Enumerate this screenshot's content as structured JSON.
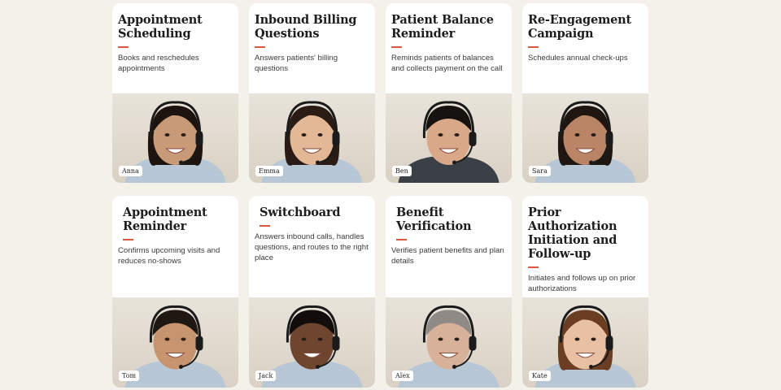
{
  "agents": [
    {
      "title": "Appointment Scheduling",
      "description": "Books and reschedules appointments",
      "name": "Anna",
      "avatar_icon": "female-agent-headset-avatar",
      "skin": "#c99a78",
      "hair": "#1e140f",
      "shirt": "#b7c7d6"
    },
    {
      "title": "Inbound Billing Questions",
      "description": "Answers patients' billing questions",
      "name": "Emma",
      "avatar_icon": "female-agent-headset-avatar",
      "skin": "#e2b897",
      "hair": "#2a1c14",
      "shirt": "#b7c7d6"
    },
    {
      "title": "Patient Balance Reminder",
      "description": "Reminds patients of balances and collects payment on the call",
      "name": "Ben",
      "avatar_icon": "male-agent-headset-avatar",
      "skin": "#d8a888",
      "hair": "#151210",
      "shirt": "#3b3f46"
    },
    {
      "title": "Re-Engagement Campaign",
      "description": "Schedules annual check-ups",
      "name": "Sara",
      "avatar_icon": "female-agent-headset-avatar",
      "skin": "#b98566",
      "hair": "#1f1611",
      "shirt": "#b7c7d6"
    },
    {
      "title": "Appointment Reminder",
      "description": "Confirms upcoming visits and reduces no-shows",
      "name": "Tom",
      "avatar_icon": "male-agent-headset-avatar",
      "skin": "#c79470",
      "hair": "#1e1712",
      "shirt": "#b7c7d6"
    },
    {
      "title": "Switchboard",
      "description": "Answers inbound calls, handles questions, and routes to the right place",
      "name": "Jack",
      "avatar_icon": "male-agent-headset-avatar",
      "skin": "#6e4630",
      "hair": "#120d0a",
      "shirt": "#b7c7d6"
    },
    {
      "title": "Benefit Verification",
      "description": "Verifies patient benefits and plan details",
      "name": "Alex",
      "avatar_icon": "male-agent-headset-avatar",
      "skin": "#d7b19a",
      "hair": "#8f8a86",
      "shirt": "#b7c7d6"
    },
    {
      "title": "Prior Authorization Initiation and Follow-up",
      "description": "Initiates and follows up on prior authorizations",
      "name": "Kate",
      "avatar_icon": "female-agent-headset-avatar",
      "skin": "#e8c0a4",
      "hair": "#6b3e24",
      "shirt": "#b7c7d6"
    }
  ],
  "colors": {
    "background": "#f4f1ea",
    "card": "#ffffff",
    "accent": "#d9573f"
  }
}
